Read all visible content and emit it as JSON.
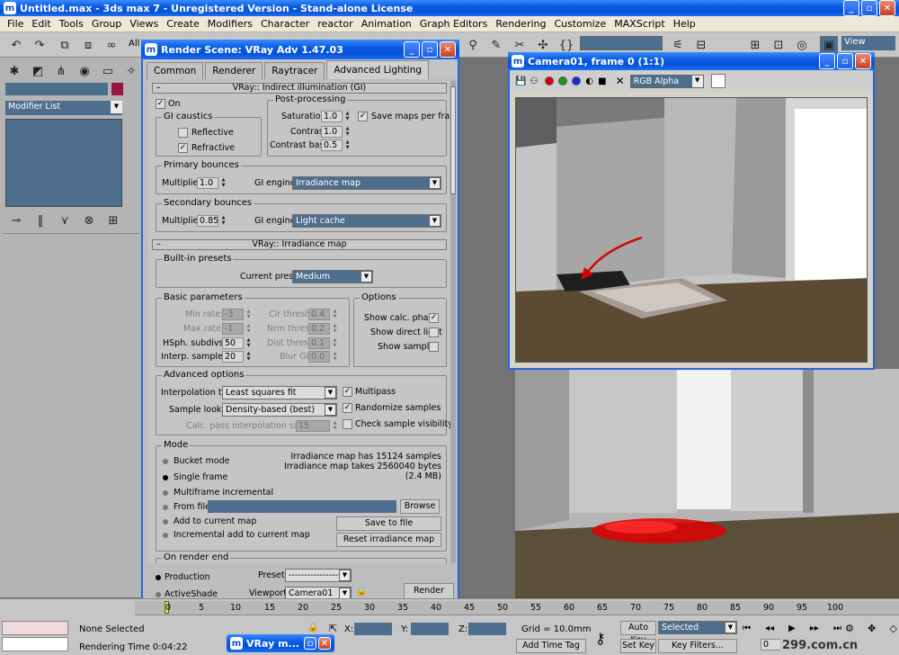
{
  "app_title": "Untitled.max - 3ds max 7 - Unregistered Version - Stand-alone License",
  "menu": [
    "File",
    "Edit",
    "Tools",
    "Group",
    "Views",
    "Create",
    "Modifiers",
    "Character",
    "reactor",
    "Animation",
    "Graph Editors",
    "Rendering",
    "Customize",
    "MAXScript",
    "Help"
  ],
  "toolbar": {
    "view_label": "View",
    "all_label": "All"
  },
  "command_panel": {
    "modifier_list": "Modifier List"
  },
  "render_scene": {
    "title": "Render Scene: VRay Adv 1.47.03",
    "tabs": [
      "Common",
      "Renderer",
      "Raytracer",
      "Advanced Lighting"
    ],
    "gi": {
      "header": "VRay:: Indirect illumination (GI)",
      "on_label": "On",
      "gi_caustics": "GI caustics",
      "reflective": "Reflective",
      "refractive": "Refractive",
      "post_processing": "Post-processing",
      "saturation_label": "Saturation:",
      "saturation": "1.0",
      "contrast_label": "Contrast:",
      "contrast": "1.0",
      "contrast_base_label": "Contrast base:",
      "contrast_base": "0.5",
      "save_maps": "Save maps per frame",
      "primary_bounces": "Primary bounces",
      "multiplier_label": "Multiplier:",
      "primary_multiplier": "1.0",
      "gi_engine_label": "GI engine:",
      "primary_engine": "Irradiance map",
      "secondary_bounces": "Secondary bounces",
      "secondary_multiplier": "0.85",
      "secondary_engine": "Light cache"
    },
    "irr": {
      "header": "VRay:: Irradiance map",
      "built_in_presets": "Built-in presets",
      "current_preset_label": "Current preset:",
      "current_preset": "Medium",
      "basic_parameters": "Basic parameters",
      "min_rate_label": "Min rate:",
      "min_rate": "-3",
      "max_rate_label": "Max rate:",
      "max_rate": "-1",
      "hsph_label": "HSph. subdivs:",
      "hsph": "50",
      "interp_label": "Interp. samples:",
      "interp": "20",
      "clr_label": "Clr thresh:",
      "clr": "0.4",
      "nrm_label": "Nrm thresh:",
      "nrm": "0.2",
      "dist_label": "Dist thresh:",
      "dist": "0.1",
      "blur_label": "Blur GI:",
      "blur": "0.0",
      "options": "Options",
      "show_calc": "Show calc. phase",
      "show_direct": "Show direct light",
      "show_samples": "Show samples",
      "advanced_options": "Advanced options",
      "interp_type_label": "Interpolation type:",
      "interp_type": "Least squares fit (good/smoot",
      "sample_lookup_label": "Sample lookup:",
      "sample_lookup": "Density-based (best)",
      "calc_pass_label": "Calc. pass interpolation samples:",
      "calc_pass": "15",
      "multipass": "Multipass",
      "randomize": "Randomize samples",
      "check_vis": "Check sample visibility",
      "mode": "Mode",
      "bucket": "Bucket mode",
      "single": "Single frame",
      "multiframe": "Multiframe incremental",
      "from_file": "From file:",
      "browse": "Browse",
      "add_current": "Add to current map",
      "incremental": "Incremental add to current map",
      "info1": "Irradiance map has 15124 samples",
      "info2": "Irradiance map takes 2560040 bytes",
      "info3": "(2.4 MB)",
      "save_to_file": "Save to file",
      "reset": "Reset irradiance map",
      "on_render_end": "On render end"
    },
    "footer": {
      "production": "Production",
      "activeshade": "ActiveShade",
      "preset_label": "Preset:",
      "preset": "------------------",
      "viewport_label": "Viewport:",
      "viewport": "Camera01",
      "render": "Render"
    }
  },
  "camera_window": {
    "title": "Camera01, frame 0 (1:1)",
    "channel": "RGB Alpha"
  },
  "bottom": {
    "none_selected": "None Selected",
    "rendering_time": "Rendering Time  0:04:22",
    "x_label": "X:",
    "y_label": "Y:",
    "z_label": "Z:",
    "grid": "Grid = 10.0mm",
    "add_time_tag": "Add Time Tag",
    "auto_key": "Auto Key",
    "set_key": "Set Key",
    "selected": "Selected",
    "key_filters": "Key Filters...",
    "frame": "0",
    "taskbar": "VRay m..."
  },
  "timeline": {
    "ticks": [
      "0",
      "5",
      "10",
      "15",
      "20",
      "25",
      "30",
      "35",
      "40",
      "45",
      "50",
      "55",
      "60",
      "65",
      "70",
      "75",
      "80",
      "85",
      "90",
      "95",
      "100"
    ]
  },
  "watermark": "299.com.cn",
  "colors": {
    "title_blue": "#0552d8",
    "dropdown_blue": "#4d6e8d",
    "vray_red": "#e00000"
  }
}
